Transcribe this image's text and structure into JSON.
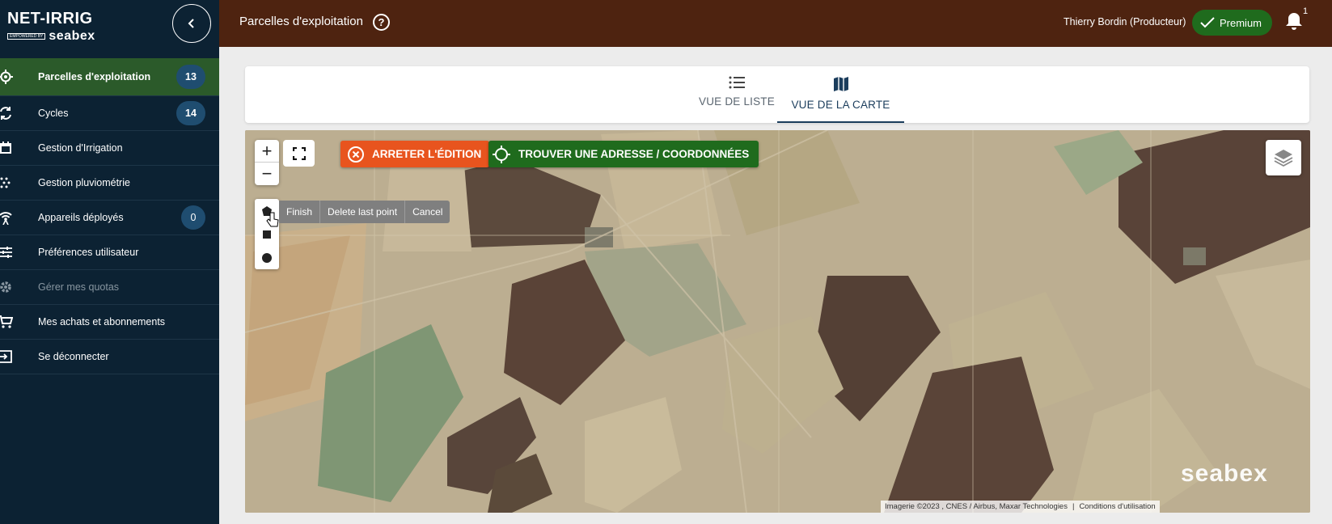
{
  "app": {
    "logo_title": "NET-IRRIG",
    "logo_powered": "EMPOWERED BY",
    "logo_brand": "seabex"
  },
  "sidebar": {
    "items": [
      {
        "label": "Parcelles d'exploitation",
        "badge": "13",
        "icon": "target-icon",
        "active": true
      },
      {
        "label": "Cycles",
        "badge": "14",
        "icon": "sync-icon"
      },
      {
        "label": "Gestion d'Irrigation",
        "icon": "calendar-icon"
      },
      {
        "label": "Gestion pluviométrie",
        "icon": "rain-dots-icon"
      },
      {
        "label": "Appareils déployés",
        "badge": "0",
        "icon": "antenna-icon"
      },
      {
        "label": "Préférences utilisateur",
        "icon": "sliders-icon"
      },
      {
        "label": "Gérer mes quotas",
        "icon": "gear-icon",
        "disabled": true
      },
      {
        "label": "Mes achats et abonnements",
        "icon": "cart-icon"
      },
      {
        "label": "Se déconnecter",
        "icon": "logout-icon"
      }
    ]
  },
  "header": {
    "title": "Parcelles d'exploitation",
    "user": "Thierry Bordin (Producteur)",
    "premium_label": "Premium",
    "notifications": "1",
    "colors": {
      "header_bg": "#4e2310",
      "accent_green": "#1f6b1d"
    }
  },
  "tabs": [
    {
      "label": "VUE DE LISTE",
      "icon": "list-icon"
    },
    {
      "label": "VUE DE LA CARTE",
      "icon": "map-icon",
      "active": true
    }
  ],
  "map": {
    "zoom_in": "+",
    "zoom_out": "−",
    "stop_edit_label": "ARRETER L'ÉDITION",
    "find_address_label": "TROUVER UNE ADRESSE / COORDONNÉES",
    "draw_actions": {
      "finish": "Finish",
      "delete_last": "Delete last point",
      "cancel": "Cancel"
    },
    "watermark": "seabex",
    "attribution": "Imagerie ©2023 , CNES / Airbus, Maxar Technologies",
    "terms": "Conditions d'utilisation"
  }
}
